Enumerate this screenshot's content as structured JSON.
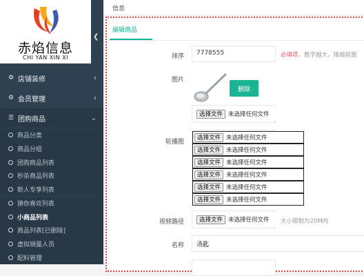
{
  "brand": {
    "title": "赤焰信息",
    "subtitle": "CHI YAN XIN XI"
  },
  "sidebar": {
    "collapse_icon": "chevron-left-icon",
    "menus": [
      {
        "label": "店铺装修",
        "icon": "cogs-icon"
      },
      {
        "label": "会员管理",
        "icon": "gear-icon"
      },
      {
        "label": "团购商品",
        "icon": "sitemap-icon"
      }
    ],
    "subitems": [
      {
        "label": "商品分类"
      },
      {
        "label": "商品分组"
      },
      {
        "label": "团购商品列表"
      },
      {
        "label": "秒杀商品列表"
      },
      {
        "label": "新人专享列表"
      },
      {
        "label": "猜你喜欢列表"
      },
      {
        "label": "小商品列表"
      },
      {
        "label": "商品列表[已删除]"
      },
      {
        "label": "虚拟销量人员"
      },
      {
        "label": "配料管理"
      }
    ]
  },
  "topbar": {
    "text": "信息"
  },
  "form": {
    "tab_label": "编辑商品",
    "sort": {
      "label": "排序",
      "value": "7778555",
      "required": "必填项",
      "help": "，数字越大，排越前面"
    },
    "image": {
      "label": "图片",
      "delete_label": "删除"
    },
    "file": {
      "button": "选择文件",
      "none": "未选择任何文件"
    },
    "carousel": {
      "label": "轮播图"
    },
    "video": {
      "label": "视频路径",
      "help": "大小限制为20M内"
    },
    "name": {
      "label": "名称",
      "value": "汤匙"
    }
  },
  "colors": {
    "accent": "#1ab394",
    "sidebar": "#2f4050",
    "required": "#ed5565"
  }
}
